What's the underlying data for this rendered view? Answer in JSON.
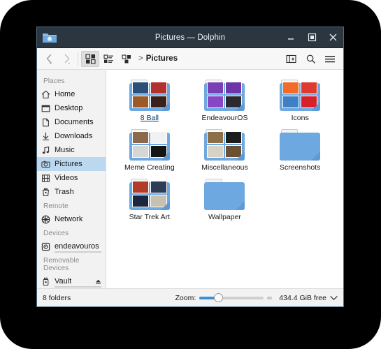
{
  "window": {
    "title": "Pictures — Dolphin",
    "app_icon": "folder-home-icon",
    "controls": {
      "minimize": "minimize-icon",
      "maximize": "maximize-icon",
      "close": "close-icon"
    }
  },
  "toolbar": {
    "back": "back-arrow-icon",
    "forward": "forward-arrow-icon",
    "view_icons": "view-icons-icon",
    "view_details": "view-details-icon",
    "view_compact": "view-compact-icon",
    "breadcrumb_separator": ">",
    "breadcrumb": "Pictures",
    "split_view": "split-view-icon",
    "search": "search-icon",
    "menu": "hamburger-menu-icon"
  },
  "sidebar": {
    "groups": [
      {
        "title": "Places",
        "items": [
          {
            "label": "Home",
            "icon": "home-icon",
            "selected": false
          },
          {
            "label": "Desktop",
            "icon": "desktop-icon",
            "selected": false
          },
          {
            "label": "Documents",
            "icon": "document-icon",
            "selected": false
          },
          {
            "label": "Downloads",
            "icon": "download-icon",
            "selected": false
          },
          {
            "label": "Music",
            "icon": "music-note-icon",
            "selected": false
          },
          {
            "label": "Pictures",
            "icon": "camera-icon",
            "selected": true
          },
          {
            "label": "Videos",
            "icon": "film-icon",
            "selected": false
          },
          {
            "label": "Trash",
            "icon": "trash-icon",
            "selected": false
          }
        ]
      },
      {
        "title": "Remote",
        "items": [
          {
            "label": "Network",
            "icon": "network-globe-icon",
            "selected": false
          }
        ]
      },
      {
        "title": "Devices",
        "items": [
          {
            "label": "endeavouros",
            "icon": "harddisk-icon",
            "selected": false,
            "capacity_pct": 18
          }
        ]
      },
      {
        "title": "Removable Devices",
        "items": [
          {
            "label": "Vault",
            "icon": "usb-drive-icon",
            "selected": false,
            "capacity_pct": 12,
            "eject": "eject-icon"
          }
        ]
      }
    ]
  },
  "content": {
    "folders": [
      {
        "name": "8 Ball",
        "hover": true,
        "thumbs": [
          "#2b4f78",
          "#b33030",
          "#9b5a27",
          "#3a1f1a"
        ]
      },
      {
        "name": "EndeavourOS",
        "hover": false,
        "thumbs": [
          "#7b3fb5",
          "#6d35a8",
          "#8845c4",
          "#2a2a30"
        ]
      },
      {
        "name": "Icons",
        "hover": false,
        "thumbs": [
          "#f06c28",
          "#e03a2e",
          "#3f7fc4",
          "#d6202a"
        ]
      },
      {
        "name": "Meme Creating",
        "hover": false,
        "thumbs": [
          "#8a6a4a",
          "#f1f1f1",
          "#d6d6d6",
          "#141414"
        ]
      },
      {
        "name": "Miscellaneous",
        "hover": false,
        "thumbs": [
          "#8b6f45",
          "#1d1d1d",
          "#d8d2c4",
          "#6b5132"
        ]
      },
      {
        "name": "Screenshots",
        "hover": false,
        "thumbs": []
      },
      {
        "name": "Star Trek Art",
        "hover": false,
        "thumbs": [
          "#b33b2a",
          "#2d3d55",
          "#1b2740",
          "#c8c0b0"
        ]
      },
      {
        "name": "Wallpaper",
        "hover": false,
        "thumbs": []
      }
    ]
  },
  "statusbar": {
    "item_count": "8 folders",
    "zoom_label": "Zoom:",
    "zoom_value": 28,
    "free_space": "434.4 GiB free",
    "free_space_chevron": "chevron-down-icon"
  },
  "colors": {
    "titlebar": "#2b3640",
    "accent": "#3b8fd4",
    "selection": "#bcd8f0",
    "folder": "#6ea8e0",
    "backdrop": "#000000"
  }
}
